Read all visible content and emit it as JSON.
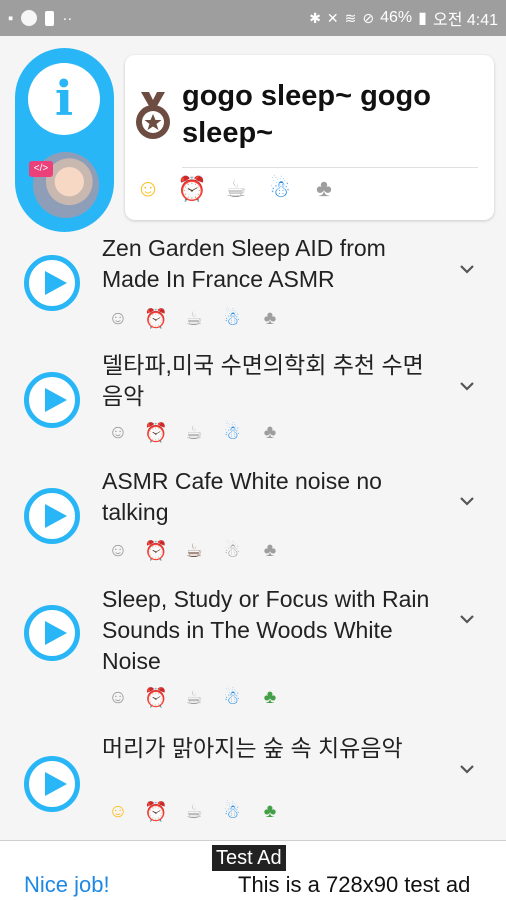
{
  "status_bar": {
    "left_icons": [
      "android-icon",
      "app-icon",
      "lock-icon",
      "more-icon"
    ],
    "right_icons": [
      "bluetooth-icon",
      "mute-icon",
      "wifi-icon",
      "no-sim-icon"
    ],
    "battery": "46%",
    "time": "오전 4:41"
  },
  "header": {
    "info_icon": "info-icon",
    "avatar_badge": "</>",
    "title": "gogo sleep~ gogo sleep~",
    "category_icons": [
      {
        "name": "smile-icon",
        "glyph": "☺",
        "color": "#fbc02d",
        "active": true
      },
      {
        "name": "alarm-icon",
        "glyph": "⏰",
        "color": "#e53935",
        "active": true
      },
      {
        "name": "coffee-icon",
        "glyph": "☕",
        "color": "#9e9e9e",
        "active": false
      },
      {
        "name": "baby-icon",
        "glyph": "☃",
        "color": "#1e88e5",
        "active": true
      },
      {
        "name": "tree-icon",
        "glyph": "♣",
        "color": "#9e9e9e",
        "active": false
      }
    ]
  },
  "playlist": [
    {
      "title": "Zen Garden Sleep AID from Made In France ASMR",
      "icons": [
        "off",
        "red",
        "off",
        "blue",
        "off"
      ]
    },
    {
      "title": "델타파,미국 수면의학회 추천 수면음악",
      "icons": [
        "off",
        "red",
        "off",
        "blue",
        "off"
      ]
    },
    {
      "title": "ASMR Cafe White noise no talking",
      "icons": [
        "off",
        "off",
        "brown",
        "off",
        "off"
      ]
    },
    {
      "title": "Sleep, Study or Focus with Rain Sounds in The Woods White Noise",
      "icons": [
        "off",
        "red",
        "off",
        "blue",
        "green"
      ]
    },
    {
      "title": "머리가 맑아지는 숲 속 치유음악",
      "icons": [
        "yellow",
        "red",
        "off",
        "blue",
        "green"
      ]
    }
  ],
  "ad": {
    "label": "Test Ad",
    "left_text": "Nice job!",
    "right_text": "This is a 728x90 test ad"
  }
}
